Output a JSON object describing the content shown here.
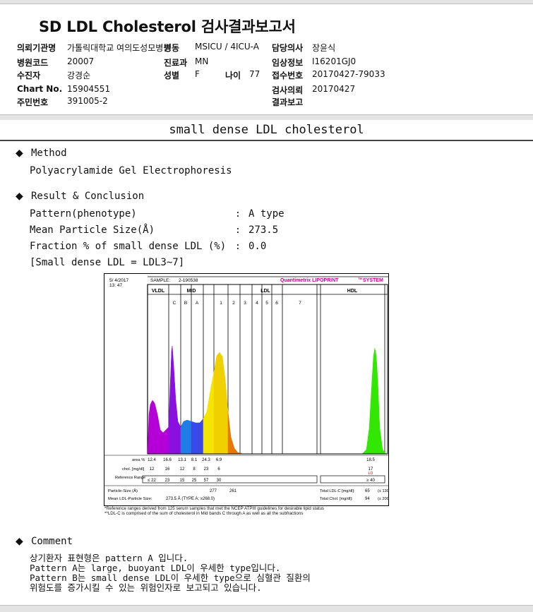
{
  "report": {
    "title": "SD LDL Cholesterol 검사결과보고서"
  },
  "header": {
    "institution_label": "의뢰기관명",
    "institution_value": "가톨릭대학교 여의도성모병원",
    "ward_label": "병동",
    "ward_value": "MSICU / 4ICU-A",
    "doctor_label": "담당의사",
    "doctor_value": "장윤식",
    "hospital_code_label": "병원코드",
    "hospital_code_value": "20007",
    "dept_label": "진료과",
    "dept_value": "MN",
    "clinical_label": "임상정보",
    "clinical_value": "I16201GJ0",
    "patient_label": "수진자",
    "patient_value": "강경순",
    "sex_label": "성별",
    "sex_value": "F",
    "age_label": "나이",
    "age_value": "77",
    "receipt_label": "접수번호",
    "receipt_value": "20170427-79033",
    "chart_label": "Chart No.",
    "chart_value": "15904551",
    "request_label": "검사의뢰",
    "request_value": "20170427",
    "id_label": "주민번호",
    "id_value": "391005-2",
    "result_report_label": "결과보고"
  },
  "section": {
    "title": "small dense LDL cholesterol"
  },
  "method": {
    "heading": "Method",
    "text": "Polyacrylamide Gel Electrophoresis"
  },
  "result": {
    "heading": "Result & Conclusion",
    "pattern_label": "Pattern(phenotype)",
    "pattern_value": "A type",
    "size_label": "Mean Particle Size(Å)",
    "size_value": "273.5",
    "fraction_label": "Fraction % of small dense LDL (%)",
    "fraction_value": "0.0",
    "definition": "[Small dense LDL = LDL3~7]",
    "colon": ":"
  },
  "chart_data": {
    "type": "area",
    "date": "5/ 4/2017",
    "time": "13: 47",
    "sample_label": "SAMPLE:",
    "sample_id": "2-190538",
    "brand": "Quantimetrix LIPOPRINT",
    "brand_tm": "TM",
    "brand_suffix": "SYSTEM",
    "group_labels": [
      "VLDL",
      "MID",
      "LDL",
      "HDL"
    ],
    "band_labels": [
      "C",
      "B",
      "A",
      "1",
      "2",
      "3",
      "4",
      "5",
      "6",
      "7"
    ],
    "row_labels": {
      "area": "area %",
      "chol": "chol. [mg/dl]",
      "reference": "Reference Range",
      "particle_size": "Particle-Size (Å)",
      "mean_size": "Mean LDL-Particle Size:"
    },
    "area_values": [
      "12.4",
      "16.6",
      "13.1",
      "8.1",
      "24.3",
      "6.9"
    ],
    "hdl_area": "18.5",
    "chol_values": [
      "12",
      "16",
      "12",
      "8",
      "23",
      "6"
    ],
    "hdl_chol": "17",
    "hdl_flag": "LO",
    "reference_values": [
      "≤ 22",
      "23",
      "15",
      "25",
      "57",
      "30"
    ],
    "hdl_reference": "≥ 40",
    "particle_sizes": [
      "277",
      "261"
    ],
    "mean_size_value": "273.5 Å  (TYPE A; ≥268.0)",
    "total_ldl_label": "Total LDL-C [mg/dl]:",
    "total_ldl_value": "65",
    "total_ldl_ref": "(≤ 130)",
    "total_chol_label": "Total Chol. [mg/dl]:",
    "total_chol_value": "94",
    "total_chol_ref": "(≤ 200)",
    "colors": {
      "vldl": "#b400d6",
      "mid_c": "#8a10e0",
      "mid_b": "#1f7de6",
      "mid_a": "#3b49e8",
      "ldl1": "#f5e400",
      "ldl2": "#f0d000",
      "ldl_tail": "#e87800",
      "hdl": "#33e800"
    }
  },
  "notes": {
    "note1": "*Reference ranges derived from 125 serum samples that met the NCEP ATPIII guidelines for desirable lipid status",
    "note2": "**LDL-C is comprised of the sum of cholesterol in Mid bands C through A as well as all the subfractions"
  },
  "comment": {
    "heading": "Comment",
    "line1": "상기환자 표현형은 pattern A 입니다.",
    "line2": "Pattern A는 large, buoyant LDL이 우세한 type입니다.",
    "line3": "Pattern B는 small dense LDL이 우세한 type으로 심혈관 질환의",
    "line4": "위험도를 증가시킬 수 있는 위험인자로 보고되고 있습니다."
  },
  "icons": {
    "bullet": "◆"
  }
}
